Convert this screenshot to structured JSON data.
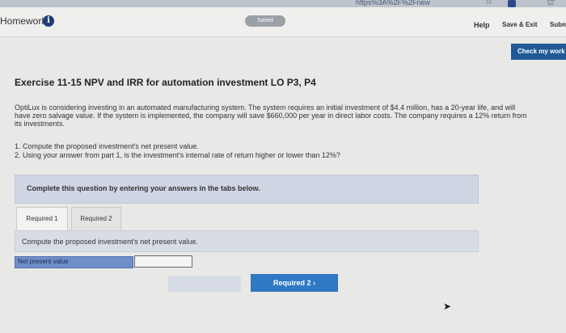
{
  "browser": {
    "url_fragment": "https%3A%2F%2Fnew",
    "star": "☆",
    "ext": "⚝"
  },
  "header": {
    "homework_label": "Homework",
    "info_glyph": "i",
    "saved_label": "Saved",
    "help_label": "Help",
    "save_exit_label": "Save & Exit",
    "submit_label": "Submit",
    "check_work_label": "Check my work"
  },
  "exercise": {
    "title": "Exercise 11-15 NPV and IRR for automation investment LO P3, P4",
    "description": "OptiLux is considering investing in an automated manufacturing system. The system requires an initial investment of $4.4 million, has a 20-year life, and will have zero salvage value. If the system is implemented, the company will save $660,000 per year in direct labor costs. The company requires a 12% return from its investments.",
    "question_1": "1. Compute the proposed investment's net present value.",
    "question_2": "2. Using your answer from part 1, is the investment's internal rate of return higher or lower than 12%?"
  },
  "instructions": "Complete this question by entering your answers in the tabs below.",
  "tabs": [
    {
      "label": "Required 1"
    },
    {
      "label": "Required 2"
    }
  ],
  "panel": {
    "prompt": "Compute the proposed investment's net present value.",
    "field_label": "Net present value",
    "field_value": ""
  },
  "nav": {
    "next_label": "Required 2  ›"
  },
  "colors": {
    "primary_blue": "#2f78c4",
    "dark_blue": "#1f5a96",
    "field_label_bg": "#6e8fc8"
  }
}
